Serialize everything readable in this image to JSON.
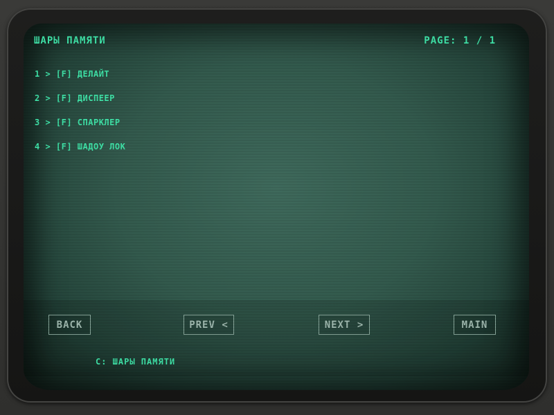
{
  "header": {
    "title": "ШАРЫ ПАМЯТИ",
    "page": "PAGE: 1 / 1"
  },
  "items": [
    {
      "label": "1 > [F] ДЕЛАЙТ"
    },
    {
      "label": "2 > [F] ДИСПЕЕР"
    },
    {
      "label": "3 > [F] СПАРКЛЕР"
    },
    {
      "label": "4 > [F] ШАДОУ ЛОК"
    }
  ],
  "nav": {
    "back": "BACK",
    "prev": "PREV <",
    "next": "NEXT >",
    "main": "MAIN"
  },
  "command_line": "C: ШАРЫ ПАМЯТИ",
  "colors": {
    "text": "#3fe3a8",
    "button_text": "#9fb8ae",
    "screen": "#335a4d"
  }
}
